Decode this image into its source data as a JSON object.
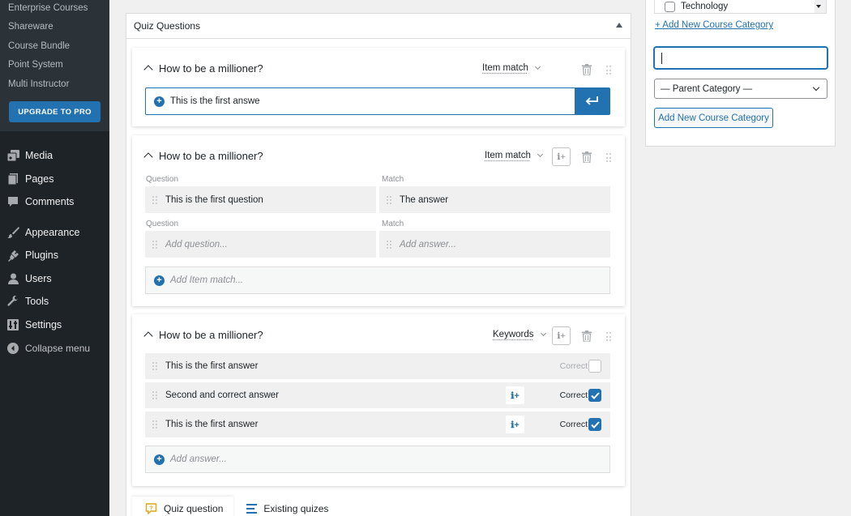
{
  "sidebar": {
    "sub_items": [
      "Enterprise Courses",
      "Shareware",
      "Course Bundle",
      "Point System",
      "Multi Instructor"
    ],
    "upgrade_label": "UPGRADE TO PRO",
    "menu": [
      {
        "label": "Media",
        "icon": "media-icon"
      },
      {
        "label": "Pages",
        "icon": "pages-icon"
      },
      {
        "label": "Comments",
        "icon": "comments-icon"
      },
      {
        "label": "Appearance",
        "icon": "appearance-icon"
      },
      {
        "label": "Plugins",
        "icon": "plugins-icon"
      },
      {
        "label": "Users",
        "icon": "users-icon"
      },
      {
        "label": "Tools",
        "icon": "tools-icon"
      },
      {
        "label": "Settings",
        "icon": "settings-icon"
      }
    ],
    "collapse_label": "Collapse menu"
  },
  "panel": {
    "title": "Quiz Questions"
  },
  "questions": [
    {
      "title": "How to be a millioner?",
      "type": "Item match",
      "answer_input_value": "This is the first answe"
    },
    {
      "title": "How to be a millioner?",
      "type": "Item match",
      "question_label": "Question",
      "match_label": "Match",
      "pairs": [
        {
          "question": "This is the first question",
          "match": "The answer"
        }
      ],
      "question_placeholder": "Add question...",
      "answer_placeholder": "Add answer...",
      "add_label": "Add Item match..."
    },
    {
      "title": "How to be a millioner?",
      "type": "Keywords",
      "answers": [
        {
          "text": "This is the first answer",
          "correct": false
        },
        {
          "text": "Second and correct answer",
          "correct": true
        },
        {
          "text": "This is the first answer",
          "correct": true
        }
      ],
      "correct_label": "Correct",
      "add_label": "Add answer..."
    }
  ],
  "tabs": [
    {
      "label": "Quiz question",
      "active": true
    },
    {
      "label": "Existing quizes",
      "active": false
    }
  ],
  "category_box": {
    "category_item": "Technology",
    "add_link": "+ Add New Course Category",
    "new_category_value": "",
    "parent_select": "— Parent Category —",
    "add_button": "Add New Course Category"
  },
  "colors": {
    "accent": "#2271b1",
    "sidebar_bg": "#1d2327",
    "submenu_bg": "#2c3338"
  }
}
